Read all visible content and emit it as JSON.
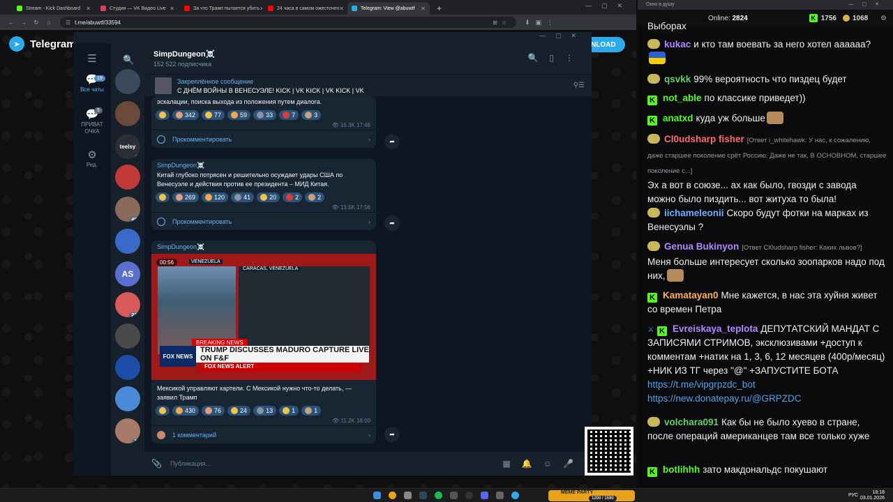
{
  "browser": {
    "tabs": [
      {
        "label": "Stream - Kick Dashboard",
        "color": "#53fc18",
        "active": false
      },
      {
        "label": "Студия — VK Видео Live",
        "color": "#e03c5c",
        "active": false
      },
      {
        "label": "За что Трамп пытается убить",
        "color": "#ff0000",
        "active": false
      },
      {
        "label": "24 часа в самом ожесточен",
        "color": "#ff0000",
        "active": false
      },
      {
        "label": "Telegram: View @abuwtf",
        "color": "#2aabee",
        "active": true
      }
    ],
    "url": "t.me/abuwtf/33594"
  },
  "webtg": {
    "logo_text": "Telegram",
    "download_label": "NLOAD"
  },
  "tg": {
    "folders": [
      {
        "label": "Все чаты",
        "badge": "19",
        "active": true
      },
      {
        "label": "ПРИВАТ ОЧКА",
        "badge": "5",
        "active": false
      },
      {
        "label": "Ред.",
        "badge": "",
        "active": false
      }
    ],
    "chat_avatars": [
      {
        "label": "",
        "color": "#3a4a5a",
        "count": ""
      },
      {
        "label": "",
        "color": "#6b4a3a",
        "count": ""
      },
      {
        "label": "teelsy",
        "color": "#2a2e36",
        "count": "1"
      },
      {
        "label": "",
        "color": "#c23a3a",
        "count": ""
      },
      {
        "label": "",
        "color": "#8a6a5a",
        "count": "483"
      },
      {
        "label": "",
        "color": "#3a6ac9",
        "count": "2"
      },
      {
        "label": "AS",
        "color": "#5b6fd1",
        "count": ""
      },
      {
        "label": "",
        "color": "#d85a5a",
        "count": "221"
      },
      {
        "label": "",
        "color": "#4a4a4a",
        "count": ""
      },
      {
        "label": "",
        "color": "#1e4fa8",
        "count": ""
      },
      {
        "label": "",
        "color": "#4a8ad8",
        "count": ""
      },
      {
        "label": "",
        "color": "#a87a6a",
        "count": "14"
      }
    ],
    "channel": {
      "name": "SimpDungeon☠️",
      "subscribers": "152 522 подписчика"
    },
    "pinned": {
      "title": "Закреплённое сообщение",
      "text": "С ДНЁМ ВОЙНЫ В ВЕНЕСУЭЛЕ!  KICK | VK KICK | VK KICK | VK"
    },
    "messages": [
      {
        "sender": "",
        "text": "эскалации, поиска выхода из положения путем диалога.",
        "reactions": [
          {
            "icon": "star-reaction",
            "color": "#f5c542",
            "count": ""
          },
          {
            "icon": "girl-reaction",
            "color": "#e89a7a",
            "count": "342"
          },
          {
            "icon": "thumbs-reaction",
            "color": "#f5c542",
            "count": "77"
          },
          {
            "icon": "sticker-reaction",
            "color": "#f5a742",
            "count": "59"
          },
          {
            "icon": "box-reaction",
            "color": "#8894a0",
            "count": "33"
          },
          {
            "icon": "heart-reaction",
            "color": "#e53935",
            "count": "7"
          },
          {
            "icon": "face-reaction",
            "color": "#c9a07a",
            "count": "3"
          }
        ],
        "views": "16.3K",
        "time": "17:48",
        "comment_label": "Прокомментировать"
      },
      {
        "sender": "SimpDungeon☠️",
        "text": "Китай глубоко потрясен и решительно осуждает удары США по Венесуэле и действия против ее президента – МИД Китая.",
        "reactions": [
          {
            "icon": "star-reaction",
            "color": "#f5c542",
            "count": ""
          },
          {
            "icon": "girl-reaction",
            "color": "#e89a7a",
            "count": "269"
          },
          {
            "icon": "sticker-reaction",
            "color": "#f5a742",
            "count": "120"
          },
          {
            "icon": "box-reaction",
            "color": "#8894a0",
            "count": "41"
          },
          {
            "icon": "thumbs-reaction",
            "color": "#f5c542",
            "count": "20"
          },
          {
            "icon": "heart-reaction",
            "color": "#e53935",
            "count": "2"
          },
          {
            "icon": "face-reaction",
            "color": "#c9a07a",
            "count": "2"
          }
        ],
        "views": "13.5K",
        "time": "17:56",
        "comment_label": "Прокомментировать"
      },
      {
        "sender": "SimpDungeon☠️",
        "video_time": "00:56",
        "video_loc": "VENEZUELA",
        "video_loc2": "CARACAS, VENEZUELA",
        "video_live": "LIVE",
        "video_breaking": "BREAKING NEWS",
        "video_headline": "TRUMP DISCUSSES MADURO CAPTURE LIVE ON F&F",
        "video_channel": "FOX NEWS",
        "video_alert": "FOX NEWS ALERT",
        "text": "Мексикой управляют картели. С Мексикой нужно что-то делать, — заявил Трамп",
        "reactions": [
          {
            "icon": "star-reaction",
            "color": "#f5c542",
            "count": ""
          },
          {
            "icon": "sticker-reaction",
            "color": "#f5a742",
            "count": "430"
          },
          {
            "icon": "girl-reaction",
            "color": "#e89a7a",
            "count": "76"
          },
          {
            "icon": "thumbs-reaction",
            "color": "#f5c542",
            "count": "24"
          },
          {
            "icon": "box-reaction",
            "color": "#8894a0",
            "count": "13"
          },
          {
            "icon": "crying-reaction",
            "color": "#f5c542",
            "count": "1"
          },
          {
            "icon": "face-reaction",
            "color": "#c9a07a",
            "count": "1"
          }
        ],
        "views": "11.2K",
        "time": "18:00",
        "comment_label": "1 комментарий"
      }
    ],
    "composer_placeholder": "Публикация..."
  },
  "stream_chat": {
    "popup_title": "Окно в душу",
    "online_label": "Online:",
    "online_count": "2824",
    "followers": "1756",
    "coins": "1068",
    "messages": [
      {
        "user": "",
        "color": "#ffffff",
        "badge": "none",
        "reply": "",
        "text": "Выборах"
      },
      {
        "user": "kukac",
        "color": "#b088ff",
        "badge": "gold",
        "reply": "",
        "text": "и кто там воевать за него хотел аааааа?"
      },
      {
        "user": "qsvkk",
        "color": "#5fd06a",
        "badge": "gold",
        "reply": "",
        "text": "99% вероятность что пиздец будет"
      },
      {
        "user": "not_able",
        "color": "#53fc18",
        "badge": "kick",
        "reply": "",
        "text": "по классике приведет))"
      },
      {
        "user": "anatxd",
        "color": "#53fc18",
        "badge": "kick",
        "reply": "",
        "text": "куда уж больше"
      },
      {
        "user": "Cl0udsharp fisher",
        "color": "#ff6b6b",
        "badge": "gold",
        "reply": "[Ответ i_whitehawk: У нас, к сожалению, даже старшее поколение срёт Россию. Даже не так, В ОСНОВНОМ, старшее поколение с...]",
        "text": "Эх а вот в союзе... ах как было, гвозди с завода можно было пиздить... вот житуха то была!"
      },
      {
        "user": "iichameleonii",
        "color": "#6ab0ff",
        "badge": "gold",
        "reply": "",
        "text": "Скоро будут фотки на марках из Венесуэлы ?"
      },
      {
        "user": "Genua Bukinyon",
        "color": "#b088ff",
        "badge": "gold",
        "reply": "[Ответ Cl0udsharp fisher: Каких львов?]",
        "text": "Меня больше интересует сколько зоопарков надо под них,"
      },
      {
        "user": "Kamatayan0",
        "color": "#ffb347",
        "badge": "kick",
        "reply": "",
        "text": "Мне кажется, в нас эта хуйня живет со времен Петра"
      },
      {
        "user": "Evreiskaya_teplota",
        "color": "#b088ff",
        "badge": "kick",
        "reply": "",
        "text": "ДЕПУТАТСКИЙ МАНДАТ С ЗАПИСЯМИ СТРИМОВ, эксклюзивами +доступ к комментам +натик на 1, 3, 6, 12 месяцев (400р/месяц) +НИК ИЗ ТГ через \"@\" +ЗАПУСТИТЕ БОТА",
        "link1": "https://t.me/vipgrpzdc_bot",
        "link2": "https://new.donatepay.ru/@GRPZDC"
      },
      {
        "user": "volchara091",
        "color": "#5fd06a",
        "badge": "gold",
        "reply": "",
        "text": "Как бы не было хуево в стране, после операций американцев там все только хуже"
      },
      {
        "user": "botlihhh",
        "color": "#53fc18",
        "badge": "kick",
        "reply": "",
        "text": "зато макдональдс покушают"
      }
    ]
  },
  "taskbar": {
    "lang": "РУС",
    "time": "18:18",
    "date": "03.01.2026",
    "media_title": "MEME PARTY",
    "media_stats": "1200 / 1590"
  }
}
